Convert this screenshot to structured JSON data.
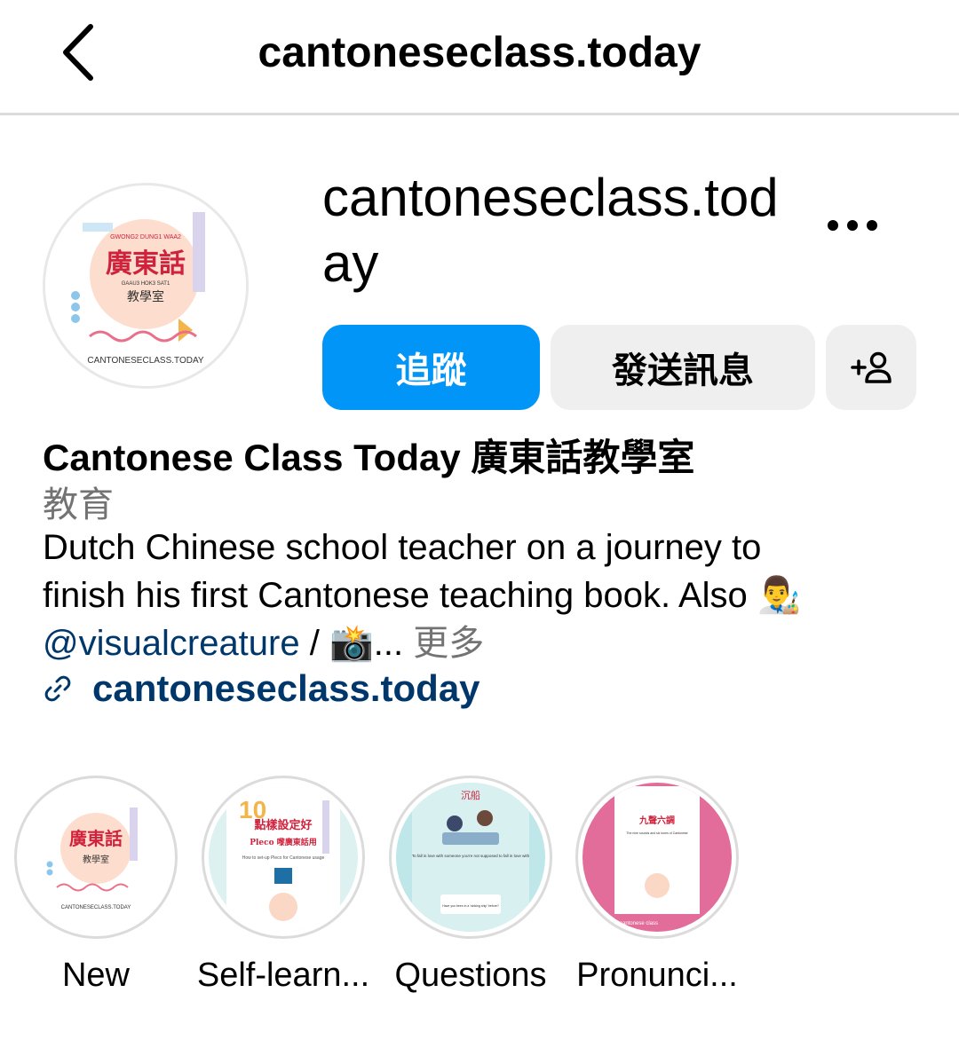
{
  "header": {
    "title": "cantoneseclass.today",
    "back_icon": "chevron-left-icon"
  },
  "profile": {
    "username": "cantoneseclass.today",
    "avatar": {
      "top_text": "GWONG2 DUNG1 WAA2",
      "chinese_title": "廣東話",
      "sub_text": "GAAU3 HOK3 SAT1",
      "chinese_sub": "教學室",
      "bottom_text": "CANTONESECLASS.TODAY"
    },
    "follow_label": "追蹤",
    "message_label": "發送訊息",
    "display_name": "Cantonese Class Today 廣東話教學室",
    "category": "教育",
    "bio_line1": "Dutch Chinese school teacher on a journey to",
    "bio_line2": "finish his first Cantonese teaching book. Also",
    "bio_emoji_artist": "👨‍🎨",
    "bio_mention": "@visualcreature",
    "bio_separator": " / ",
    "bio_emoji_camera": "📸",
    "bio_ellipsis": "... ",
    "bio_more": "更多",
    "website": "cantoneseclass.today"
  },
  "highlights": [
    {
      "label": "New",
      "thumb_title": "廣東話",
      "thumb_sub": "教學室",
      "thumb_foot": "CANTONESECLASS.TODAY"
    },
    {
      "label": "Self-learn...",
      "thumb_title": "點樣設定好",
      "thumb_sub": "Pleco 嚟廣東話用",
      "thumb_foot": "How to set-up Pleco for Cantonese usage"
    },
    {
      "label": "Questions",
      "thumb_title": "沉船",
      "thumb_sub": "To fall in love with someone you're not supposed to fall in love with",
      "thumb_foot": "Have you been in a 'sinking ship' before?"
    },
    {
      "label": "Pronunci...",
      "thumb_title": "九聲六調",
      "thumb_sub": "The nine sounds and six tones of Cantonese",
      "thumb_foot": "cantonese class"
    }
  ],
  "colors": {
    "primary_blue": "#0095f6",
    "link_blue": "#00376b",
    "secondary_gray": "#737373",
    "button_gray": "#efefef",
    "divider": "#dbdbdb",
    "brand_red": "#d0223c",
    "pink": "#e26d9a"
  }
}
